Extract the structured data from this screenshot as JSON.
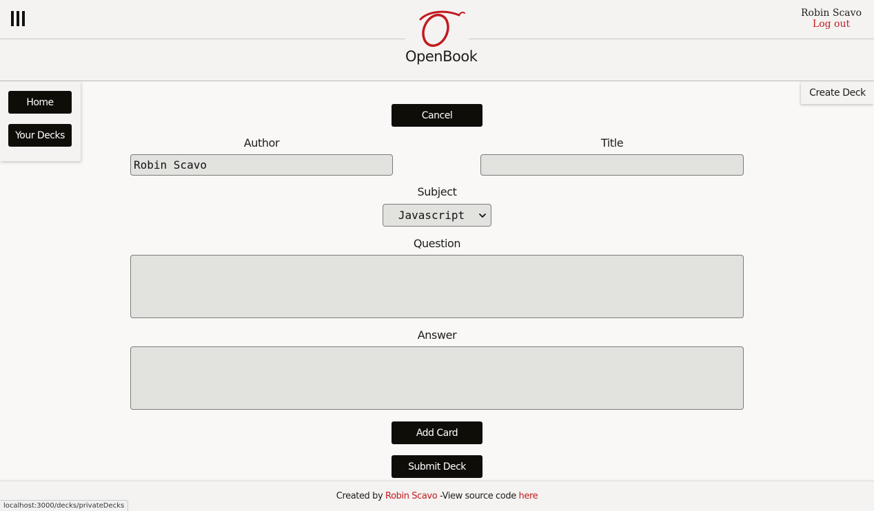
{
  "header": {
    "brand": "OpenBook",
    "logo_letter": "O",
    "menu_icon": "hamburger-menu-icon",
    "user": {
      "name": "Robin Scavo",
      "logout_label": "Log out"
    }
  },
  "sidebar": {
    "items": [
      {
        "label": "Home"
      },
      {
        "label": "Your Decks"
      }
    ]
  },
  "page": {
    "tab_label": "Create Deck"
  },
  "form": {
    "cancel_label": "Cancel",
    "author": {
      "label": "Author",
      "value": "Robin Scavo"
    },
    "title": {
      "label": "Title",
      "value": ""
    },
    "subject": {
      "label": "Subject",
      "selected": "Javascript"
    },
    "question": {
      "label": "Question",
      "value": ""
    },
    "answer": {
      "label": "Answer",
      "value": ""
    },
    "add_card_label": "Add Card",
    "submit_label": "Submit Deck"
  },
  "footer": {
    "created_by_prefix": "Created by",
    "author_link": "Robin Scavo",
    "source_text": "-View source code",
    "source_link": "here"
  },
  "status_bar": {
    "url": "localhost:3000/decks/privateDecks"
  },
  "colors": {
    "accent_red": "#c2191f",
    "button_dark": "#0f0d08",
    "input_bg": "#e2e2df"
  }
}
